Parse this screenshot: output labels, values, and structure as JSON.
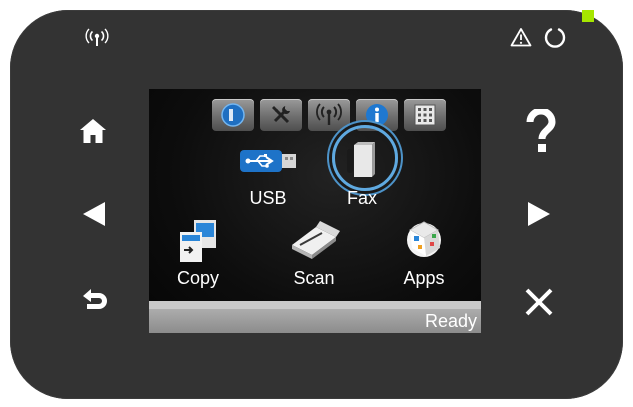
{
  "colors": {
    "panel": "#333333",
    "led": "#a6e600",
    "screen_bg": "#0d0d0d",
    "highlight_ring": "#5fa9e0",
    "status_bar": "#9e9e9e"
  },
  "panel": {
    "wireless_icon": "wireless-icon",
    "warning_icon": "warning-icon",
    "power_icon": "power-icon",
    "left_buttons": [
      "home-icon",
      "left-arrow-icon",
      "back-icon"
    ],
    "right_buttons": [
      "help-icon",
      "right-arrow-icon",
      "cancel-icon"
    ]
  },
  "screen": {
    "top_buttons": [
      "web-services-icon",
      "setup-icon",
      "wireless-icon",
      "info-icon",
      "supplies-icon"
    ],
    "apps": [
      {
        "id": "usb",
        "label": "USB",
        "icon": "usb-icon",
        "selected": false
      },
      {
        "id": "fax",
        "label": "Fax",
        "icon": "fax-icon",
        "selected": true
      },
      {
        "id": "copy",
        "label": "Copy",
        "icon": "copy-icon",
        "selected": false
      },
      {
        "id": "scan",
        "label": "Scan",
        "icon": "scan-icon",
        "selected": false
      },
      {
        "id": "apps",
        "label": "Apps",
        "icon": "apps-icon",
        "selected": false
      }
    ],
    "status": "Ready"
  }
}
